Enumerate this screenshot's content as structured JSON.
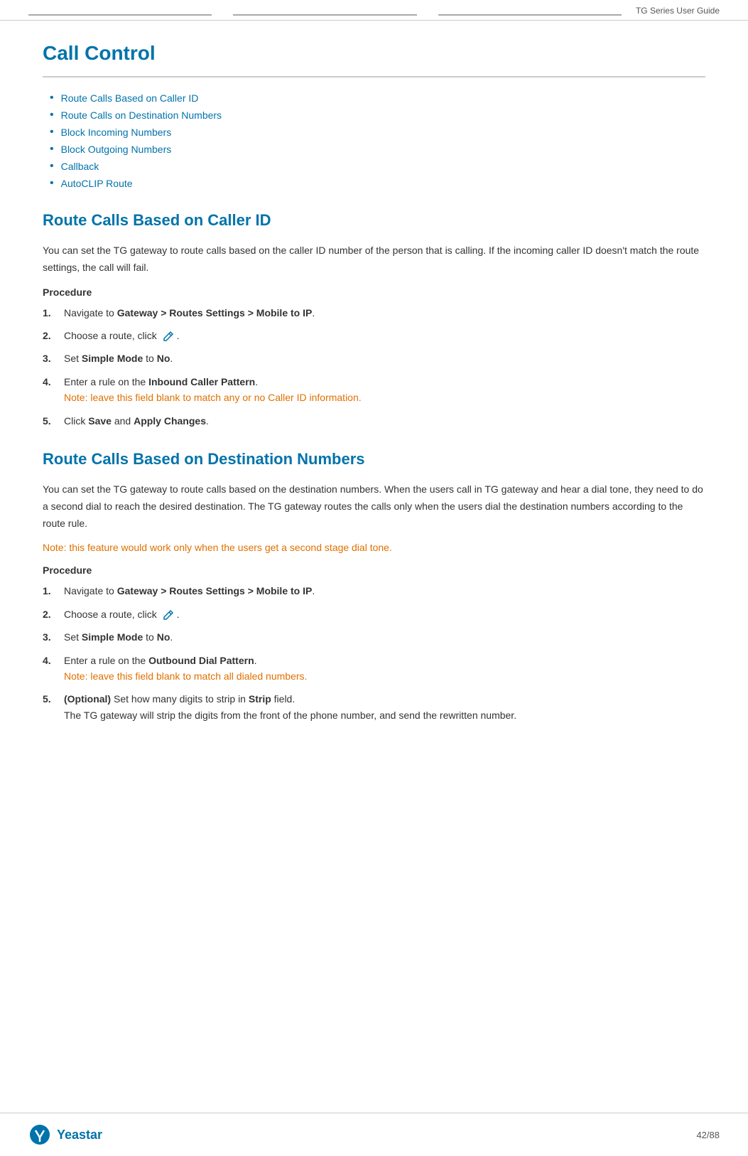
{
  "header": {
    "title": "TG  Series  User  Guide",
    "lines": [
      "",
      "",
      ""
    ]
  },
  "page": {
    "title": "Call Control",
    "toc": [
      "Route Calls Based on Caller ID",
      "Route Calls on Destination Numbers",
      "Block Incoming Numbers",
      "Block Outgoing Numbers",
      "Callback",
      "AutoCLIP  Route"
    ],
    "sections": [
      {
        "id": "section1",
        "title": "Route Calls  Based on Caller  ID",
        "body1": "You can set the TG gateway to route calls based on the caller ID number of the person that is  calling. If the incoming caller ID doesn't match the route settings, the call will fail.",
        "procedure_label": "Procedure",
        "steps": [
          {
            "num": "1.",
            "text": "Navigate  to ",
            "bold": "Gateway > Routes Settings > Mobile to IP",
            "after": "."
          },
          {
            "num": "2.",
            "text": "Choose a route, click ",
            "has_icon": true,
            "after": "."
          },
          {
            "num": "3.",
            "text": "Set ",
            "bold": "Simple Mode",
            "after": " to ",
            "bold2": "No",
            "end": "."
          },
          {
            "num": "4.",
            "text": "Enter a rule on the ",
            "bold": "Inbound Caller Pattern",
            "after": ".",
            "note": "Note: leave this field blank to match any or no Caller ID  information."
          },
          {
            "num": "5.",
            "text": "Click ",
            "bold": "Save",
            "after": " and ",
            "bold2": "Apply  Changes",
            "end": "."
          }
        ]
      },
      {
        "id": "section2",
        "title": "Route Calls  Based on Destination  Numbers",
        "body1": "You can set the TG gateway to route calls based on the destination numbers. When the users call in TG gateway and hear a dial tone, they need to do a second dial to reach the desired destination. The TG gateway routes the calls only when the users dial the destination numbers according to the route rule.",
        "note_top": "Note: this feature would work only when the users get a second stage dial  tone.",
        "procedure_label": "Procedure",
        "steps": [
          {
            "num": "1.",
            "text": "Navigate  to ",
            "bold": "Gateway > Routes Settings > Mobile to IP",
            "after": "."
          },
          {
            "num": "2.",
            "text": "Choose a route, click ",
            "has_icon": true,
            "after": "."
          },
          {
            "num": "3.",
            "text": "Set ",
            "bold": "Simple Mode",
            "after": " to ",
            "bold2": "No",
            "end": "."
          },
          {
            "num": "4.",
            "text": "Enter a rule on the ",
            "bold": "Outbound Dial Pattern",
            "after": ".",
            "note": "Note: leave this field blank to match all dialed  numbers."
          },
          {
            "num": "5.",
            "text": "(Optional)",
            "bold": "",
            "after": " Set how many digits  to strip in ",
            "bold2": "Strip",
            "end": " field.",
            "extra": "The TG gateway will strip the digits  from  the front of the phone number, and send the rewritten number."
          }
        ]
      }
    ]
  },
  "footer": {
    "brand": "Yeastar",
    "page": "42/88"
  }
}
